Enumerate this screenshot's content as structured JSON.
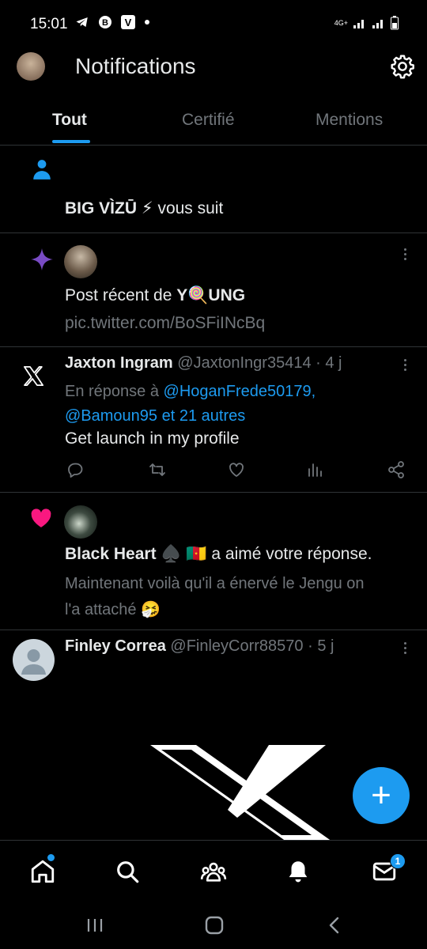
{
  "status_bar": {
    "time": "15:01",
    "network": "4G+"
  },
  "header": {
    "title": "Notifications"
  },
  "tabs": [
    {
      "label": "Tout"
    },
    {
      "label": "Certifié"
    },
    {
      "label": "Mentions"
    }
  ],
  "notifications": {
    "follow": {
      "name": "BIG VÌZŪ ⚡",
      "text": "vous suit"
    },
    "recent_post": {
      "prefix": "Post récent de",
      "name": "Y🍭UNG",
      "link": "pic.twitter.com/BoSFiINcBq"
    },
    "reply": {
      "name": "Jaxton Ingram",
      "handle": "@JaxtonIngr35414",
      "time": "· 4 j",
      "reply_prefix": "En réponse à",
      "reply_to": "@HoganFrede50179,",
      "reply_to2": "@Bamoun95 et 21 autres",
      "body": "Get launch in my profile"
    },
    "like": {
      "name": "Black Heart ♠️ 🇨🇲",
      "text": "a aimé votre réponse.",
      "quote_line1": "Maintenant voilà qu'il a énervé le Jengu on",
      "quote_line2": "l'a attaché 🤧"
    },
    "finley": {
      "name": "Finley Correa",
      "handle": "@FinleyCorr88570",
      "time": "· 5 j"
    }
  },
  "fab": {
    "label": "+"
  },
  "bottom_nav": {
    "messages_badge": "1"
  },
  "colors": {
    "accent": "#1d9bf0",
    "like": "#f91880",
    "star": "#794bc4",
    "background": "#000000"
  }
}
